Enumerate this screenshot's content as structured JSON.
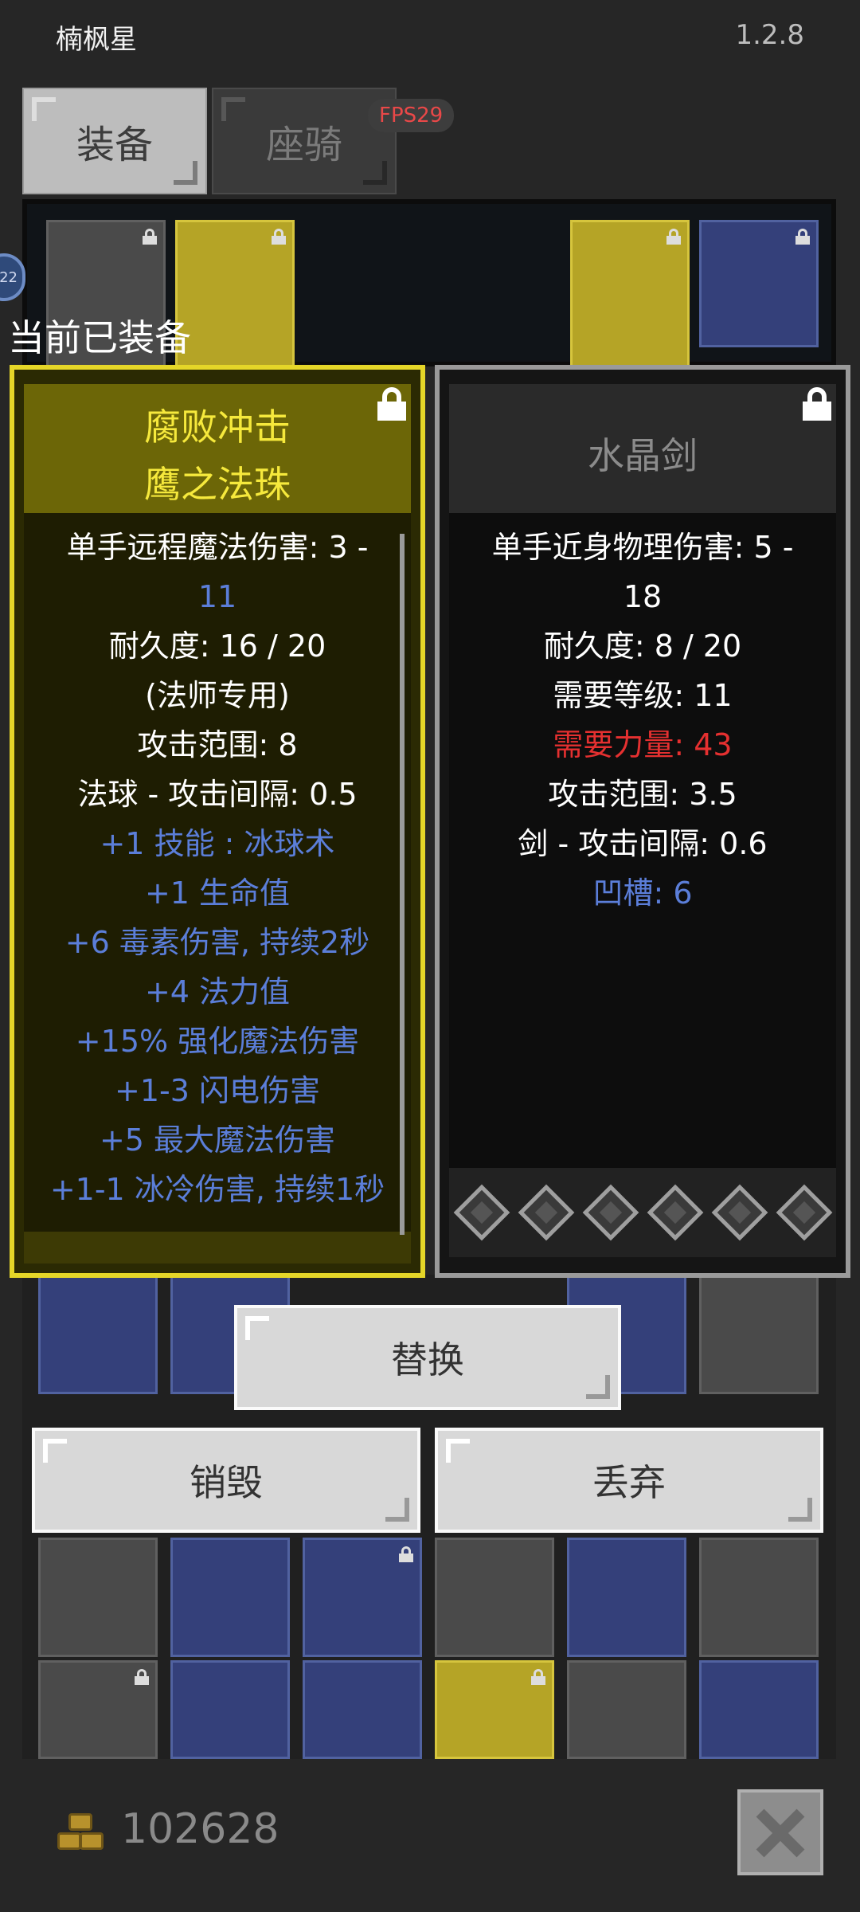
{
  "header": {
    "title": "楠枫星",
    "version": "1.2.8"
  },
  "tabs": [
    {
      "label": "装备",
      "active": true
    },
    {
      "label": "座骑",
      "active": false
    }
  ],
  "fps": "FPS29",
  "equipped_label": "当前已装备",
  "side_badge": "22",
  "left_item": {
    "name_line1": "腐败冲击",
    "name_line2": "鹰之法珠",
    "stats": [
      {
        "text": "单手远程魔法伤害: 3 -",
        "color": "white"
      },
      {
        "text": "11",
        "color": "blue"
      },
      {
        "text": "耐久度: 16 / 20",
        "color": "white"
      },
      {
        "text": "(法师专用)",
        "color": "white"
      },
      {
        "text": "攻击范围: 8",
        "color": "white"
      },
      {
        "text": "法球 - 攻击间隔: 0.5",
        "color": "white"
      },
      {
        "text": "+1 技能 : 冰球术",
        "color": "blue"
      },
      {
        "text": "+1 生命值",
        "color": "blue"
      },
      {
        "text": "+6 毒素伤害, 持续2秒",
        "color": "blue"
      },
      {
        "text": "+4 法力值",
        "color": "blue"
      },
      {
        "text": "+15% 强化魔法伤害",
        "color": "blue"
      },
      {
        "text": "+1-3 闪电伤害",
        "color": "blue"
      },
      {
        "text": "+5 最大魔法伤害",
        "color": "blue"
      },
      {
        "text": "+1-1 冰冷伤害, 持续1秒",
        "color": "blue"
      }
    ]
  },
  "right_item": {
    "name": "水晶剑",
    "stats": [
      {
        "text": "单手近身物理伤害: 5 -",
        "color": "white"
      },
      {
        "text": "18",
        "color": "white"
      },
      {
        "text": "耐久度: 8 / 20",
        "color": "white"
      },
      {
        "text": "需要等级: 11",
        "color": "white"
      },
      {
        "text": "需要力量: 43",
        "color": "red"
      },
      {
        "text": "攻击范围: 3.5",
        "color": "white"
      },
      {
        "text": "剑 - 攻击间隔: 0.6",
        "color": "white"
      },
      {
        "text": "凹槽: 6",
        "color": "blue"
      }
    ],
    "sockets": 6
  },
  "actions": {
    "replace": "替换",
    "destroy": "销毁",
    "discard": "丢弃"
  },
  "gold": "102628",
  "colors": {
    "white": "#ffffff",
    "blue": "#5b7ed9",
    "red": "#e53030",
    "gold_title": "#f6e93c"
  }
}
